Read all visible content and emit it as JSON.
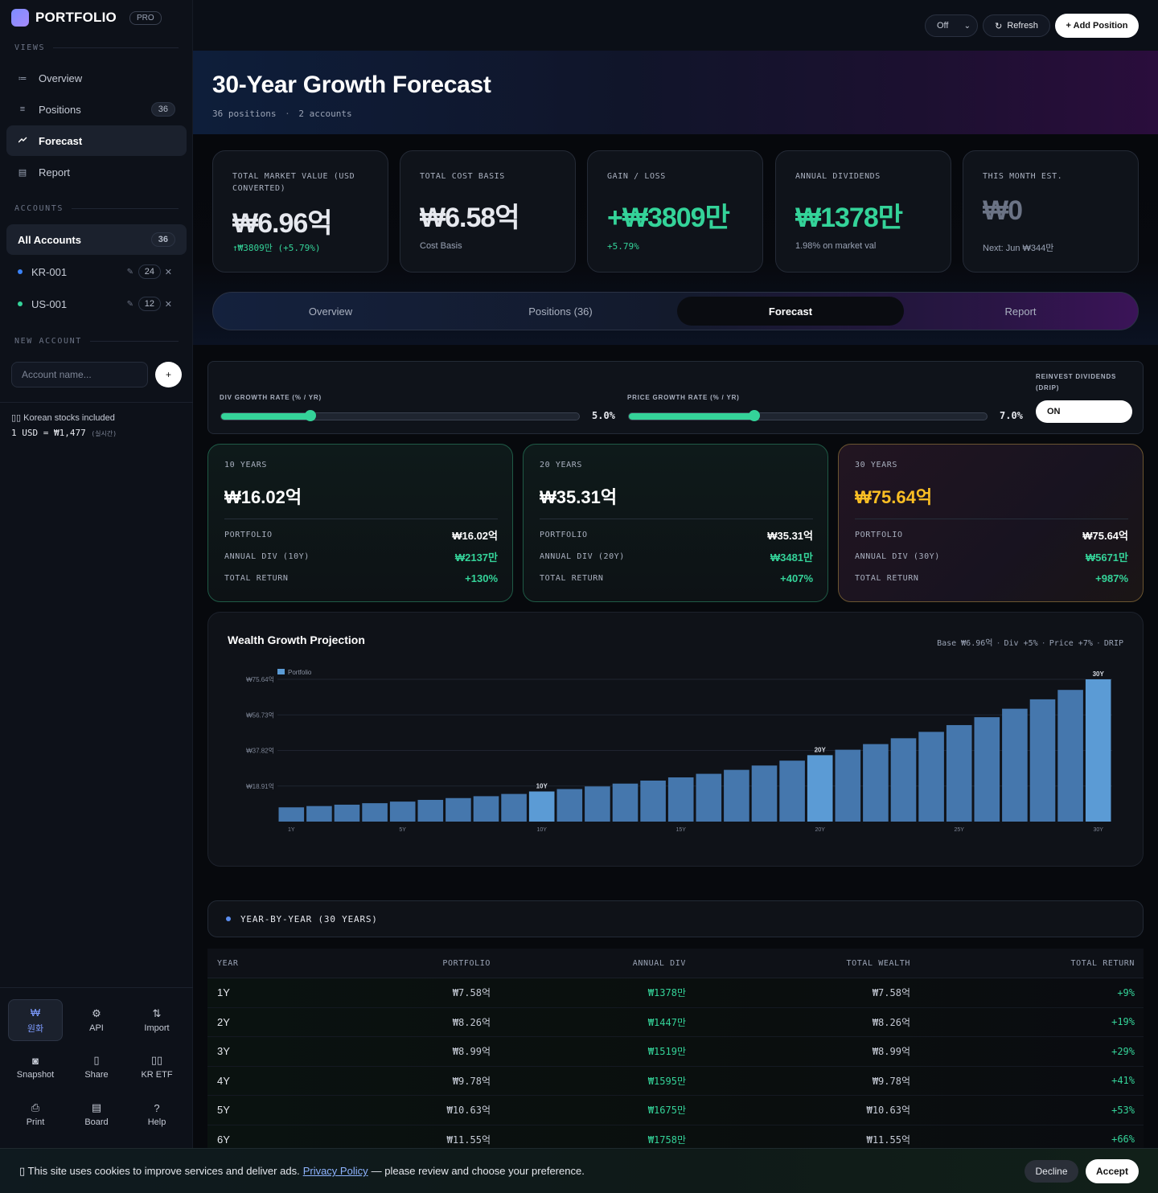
{
  "brand": {
    "name": "PORTFOLIO",
    "badge": "PRO"
  },
  "sidebar": {
    "views_label": "VIEWS",
    "views": [
      {
        "label": "Overview",
        "icon": "list-icon"
      },
      {
        "label": "Positions",
        "icon": "rows-icon",
        "badge": "36"
      },
      {
        "label": "Forecast",
        "icon": "trend-icon",
        "active": true
      },
      {
        "label": "Report",
        "icon": "document-icon"
      }
    ],
    "accounts_label": "ACCOUNTS",
    "all_accounts": {
      "label": "All Accounts",
      "count": "36"
    },
    "accounts": [
      {
        "name": "KR-001",
        "count": "24",
        "color": "#3b82f6"
      },
      {
        "name": "US-001",
        "count": "12",
        "color": "#34d399"
      }
    ],
    "new_account_label": "NEW ACCOUNT",
    "new_account_placeholder": "Account name...",
    "new_account_button": "+",
    "note": "▯▯ Korean stocks included",
    "rate": "1 USD = ₩1,477",
    "rate_note": "(실시간)",
    "tools": [
      {
        "label": "원화",
        "icon": "₩",
        "active": true
      },
      {
        "label": "API",
        "icon": "⚙"
      },
      {
        "label": "Import",
        "icon": "⇅"
      },
      {
        "label": "Snapshot",
        "icon": "◙"
      },
      {
        "label": "Share",
        "icon": "▯"
      },
      {
        "label": "KR ETF",
        "icon": "▯▯"
      },
      {
        "label": "Print",
        "icon": "⎙"
      },
      {
        "label": "Board",
        "icon": "▤"
      },
      {
        "label": "Help",
        "icon": "?"
      }
    ]
  },
  "topbar": {
    "select_value": "Off",
    "refresh": "Refresh",
    "refresh_icon": "↻",
    "add": "+ Add Position"
  },
  "hero": {
    "title": "30-Year Growth Forecast",
    "positions": "36 positions",
    "dot": "·",
    "accounts": "2 accounts"
  },
  "kpis": [
    {
      "label": "TOTAL MARKET VALUE (USD CONVERTED)",
      "value": "₩6.96억",
      "foot": "↑₩3809만 (+5.79%)"
    },
    {
      "label": "TOTAL COST BASIS",
      "value": "₩6.58억",
      "foot": "Cost Basis"
    },
    {
      "label": "GAIN / LOSS",
      "value": "+₩3809만",
      "foot": "+5.79%"
    },
    {
      "label": "ANNUAL DIVIDENDS",
      "value": "₩1378만",
      "foot": "1.98% on market val"
    },
    {
      "label": "THIS MONTH EST.",
      "value": "₩0",
      "foot": "Next: Jun ₩344만"
    }
  ],
  "tabs": [
    {
      "label": "Overview"
    },
    {
      "label": "Positions (36)"
    },
    {
      "label": "Forecast",
      "active": true
    },
    {
      "label": "Report"
    }
  ],
  "controls": {
    "div_label": "DIV GROWTH RATE (% / YR)",
    "div_value": "5.0%",
    "div_pct": 0.25,
    "price_label": "PRICE GROWTH RATE (% / YR)",
    "price_value": "7.0%",
    "price_pct": 0.35,
    "drip_label": "REINVEST DIVIDENDS (DRIP)",
    "drip_value": "ON"
  },
  "horizons": [
    {
      "label": "10 YEARS",
      "big": "₩16.02억",
      "portfolio_k": "PORTFOLIO",
      "portfolio": "₩16.02억",
      "div_k": "ANNUAL DIV (10Y)",
      "div": "₩2137만",
      "ret_k": "TOTAL RETURN",
      "ret": "+130%"
    },
    {
      "label": "20 YEARS",
      "big": "₩35.31억",
      "portfolio_k": "PORTFOLIO",
      "portfolio": "₩35.31억",
      "div_k": "ANNUAL DIV (20Y)",
      "div": "₩3481만",
      "ret_k": "TOTAL RETURN",
      "ret": "+407%"
    },
    {
      "label": "30 YEARS",
      "big": "₩75.64억",
      "portfolio_k": "PORTFOLIO",
      "portfolio": "₩75.64억",
      "div_k": "ANNUAL DIV (30Y)",
      "div": "₩5671만",
      "ret_k": "TOTAL RETURN",
      "ret": "+987%"
    }
  ],
  "chart": {
    "title": "Wealth Growth Projection",
    "meta": [
      "Base ₩6.96억",
      "Div +5%",
      "Price +7%",
      "DRIP"
    ],
    "meta_sep": "·"
  },
  "chart_data": {
    "type": "bar",
    "legend": [
      "Portfolio"
    ],
    "legend_color": "#5b9bd5",
    "categories": [
      "1Y",
      "2Y",
      "3Y",
      "4Y",
      "5Y",
      "6Y",
      "7Y",
      "8Y",
      "9Y",
      "10Y",
      "11Y",
      "12Y",
      "13Y",
      "14Y",
      "15Y",
      "16Y",
      "17Y",
      "18Y",
      "19Y",
      "20Y",
      "21Y",
      "22Y",
      "23Y",
      "24Y",
      "25Y",
      "26Y",
      "27Y",
      "28Y",
      "29Y",
      "30Y"
    ],
    "x_tick_labels": [
      "1Y",
      "5Y",
      "10Y",
      "15Y",
      "20Y",
      "25Y",
      "30Y"
    ],
    "y_tick_labels": [
      "₩75.64억",
      "₩56.73억",
      "₩37.82억",
      "₩18.91억"
    ],
    "y_ticks": [
      75.64,
      56.73,
      37.82,
      18.91
    ],
    "series": [
      {
        "name": "Portfolio",
        "values": [
          7.58,
          8.26,
          8.99,
          9.78,
          10.63,
          11.55,
          12.5,
          13.5,
          14.7,
          16.02,
          17.3,
          18.7,
          20.2,
          21.8,
          23.5,
          25.4,
          27.5,
          29.8,
          32.4,
          35.31,
          38.2,
          41.2,
          44.3,
          47.7,
          51.3,
          55.5,
          60.0,
          65.0,
          70.0,
          75.64
        ]
      }
    ],
    "highlight": {
      "10Y": "10Y",
      "20Y": "20Y",
      "30Y": "30Y"
    },
    "ylim": [
      0,
      75.64
    ]
  },
  "table": {
    "section_title": "YEAR-BY-YEAR (30 YEARS)",
    "headers": [
      "YEAR",
      "PORTFOLIO",
      "ANNUAL DIV",
      "TOTAL WEALTH",
      "TOTAL RETURN"
    ],
    "rows": [
      [
        "1Y",
        "₩7.58억",
        "₩1378만",
        "₩7.58억",
        "+9%"
      ],
      [
        "2Y",
        "₩8.26억",
        "₩1447만",
        "₩8.26억",
        "+19%"
      ],
      [
        "3Y",
        "₩8.99억",
        "₩1519만",
        "₩8.99억",
        "+29%"
      ],
      [
        "4Y",
        "₩9.78억",
        "₩1595만",
        "₩9.78억",
        "+41%"
      ],
      [
        "5Y",
        "₩10.63억",
        "₩1675만",
        "₩10.63억",
        "+53%"
      ],
      [
        "6Y",
        "₩11.55억",
        "₩1758만",
        "₩11.55억",
        "+66%"
      ]
    ]
  },
  "cookie": {
    "text_before": "▯ This site uses cookies to improve services and deliver ads.",
    "link": "Privacy Policy",
    "text_after": "— please review and choose your preference.",
    "decline": "Decline",
    "accept": "Accept"
  }
}
